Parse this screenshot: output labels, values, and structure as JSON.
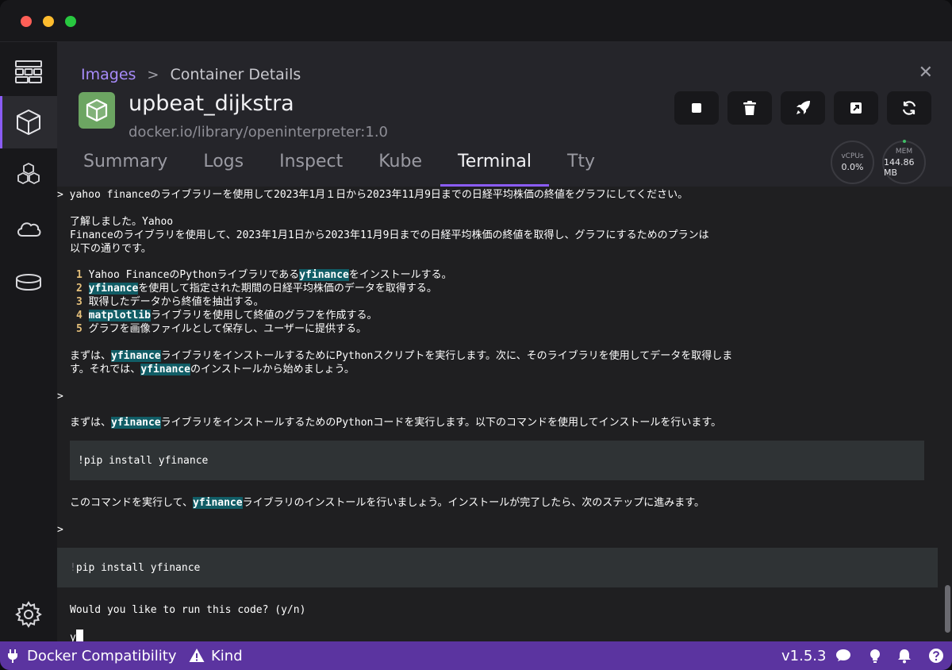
{
  "nav": {
    "items": [
      {
        "name": "dashboard-icon"
      },
      {
        "name": "containers-icon"
      },
      {
        "name": "images-icon"
      },
      {
        "name": "cloud-icon"
      },
      {
        "name": "volumes-icon"
      }
    ],
    "settings_icon": "gear-icon"
  },
  "breadcrumb": {
    "parent": "Images",
    "separator": ">",
    "current": "Container Details"
  },
  "container": {
    "name": "upbeat_dijkstra",
    "image": "docker.io/library/openinterpreter:1.0"
  },
  "actions": [
    {
      "name": "stop-button",
      "icon": "stop-icon"
    },
    {
      "name": "delete-button",
      "icon": "trash-icon"
    },
    {
      "name": "deploy-button",
      "icon": "rocket-icon"
    },
    {
      "name": "open-external-button",
      "icon": "external-link-icon"
    },
    {
      "name": "restart-button",
      "icon": "refresh-icon"
    }
  ],
  "stats": {
    "cpu_label": "vCPUs",
    "cpu_value": "0.0%",
    "mem_label": "MEM",
    "mem_value": "144.86 MB"
  },
  "tabs": [
    {
      "label": "Summary",
      "active": false
    },
    {
      "label": "Logs",
      "active": false
    },
    {
      "label": "Inspect",
      "active": false
    },
    {
      "label": "Kube",
      "active": false
    },
    {
      "label": "Terminal",
      "active": true
    },
    {
      "label": "Tty",
      "active": false
    }
  ],
  "terminal": {
    "prompt_line": "> yahoo financeのライブラリーを使用して2023年1月１日から2023年11月9日までの日経平均株価の終値をグラフにしてください。",
    "reply_l1": "了解しました。Yahoo",
    "reply_l2": "Financeのライブラリを使用して、2023年1月1日から2023年11月9日までの日経平均株価の終値を取得し、グラフにするためのプランは",
    "reply_l3": "以下の通りです。",
    "steps": [
      {
        "n": "1",
        "pre": "Yahoo FinanceのPythonライブラリである",
        "hl": "yfinance",
        "post": "をインストールする。"
      },
      {
        "n": "2",
        "pre": "",
        "hl": "yfinance",
        "post": "を使用して指定された期間の日経平均株価のデータを取得する。"
      },
      {
        "n": "3",
        "pre": "取得したデータから終値を抽出する。",
        "hl": "",
        "post": ""
      },
      {
        "n": "4",
        "pre": "",
        "hl": "matplotlib",
        "post": "ライブラリを使用して終値のグラフを作成する。"
      },
      {
        "n": "5",
        "pre": "グラフを画像ファイルとして保存し、ユーザーに提供する。",
        "hl": "",
        "post": ""
      }
    ],
    "para1_a": "まずは、",
    "para1_hl": "yfinance",
    "para1_b": "ライブラリをインストールするためにPythonスクリプトを実行します。次に、そのライブラリを使用してデータを取得しま",
    "para1_c": "す。それでは、",
    "para1_hl2": "yfinance",
    "para1_d": "のインストールから始めましょう。",
    "prompt2": ">",
    "para2_a": "まずは、",
    "para2_hl": "yfinance",
    "para2_b": "ライブラリをインストールするためのPythonコードを実行します。以下のコマンドを使用してインストールを行います。",
    "code1": "!pip install yfinance",
    "para3_a": "このコマンドを実行して、",
    "para3_hl": "yfinance",
    "para3_b": "ライブラリのインストールを行いましょう。インストールが完了したら、次のステップに進みます。",
    "prompt3": ">",
    "code2_bang": "!",
    "code2": "pip install yfinance",
    "question": "Would you like to run this code? (y/n)",
    "input": "y"
  },
  "statusbar": {
    "docker_compat": "Docker Compatibility",
    "kind": "Kind",
    "version": "v1.5.3"
  },
  "colors": {
    "accent": "#8b5cf6",
    "statusbar": "#5b34a0",
    "highlight": "#115d66",
    "container_icon": "#6ca562"
  }
}
